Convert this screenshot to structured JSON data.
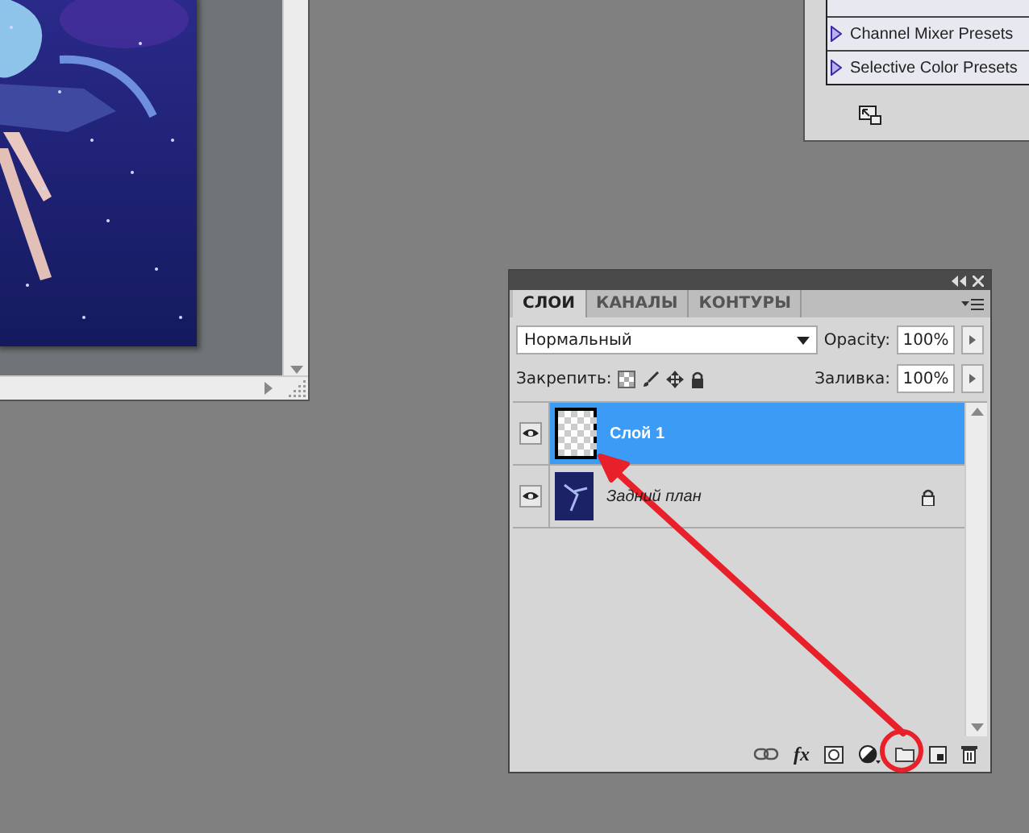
{
  "presets_panel": {
    "items": [
      {
        "label": "Channel Mixer Presets"
      },
      {
        "label": "Selective Color Presets"
      }
    ]
  },
  "layers_panel": {
    "tabs": [
      {
        "label": "СЛОИ",
        "selected": true
      },
      {
        "label": "КАНАЛЫ",
        "selected": false
      },
      {
        "label": "КОНТУРЫ",
        "selected": false
      }
    ],
    "blend_mode": "Нормальный",
    "opacity_label": "Opacity:",
    "opacity": "100%",
    "lock_label": "Закрепить:",
    "fill_label": "Заливка:",
    "fill": "100%",
    "layers": [
      {
        "name": "Слой 1",
        "kind": "layer",
        "selected": true,
        "visible": true,
        "locked": false
      },
      {
        "name": "Задний план",
        "kind": "background",
        "selected": false,
        "visible": true,
        "locked": true
      }
    ],
    "fx_label": "fx"
  }
}
